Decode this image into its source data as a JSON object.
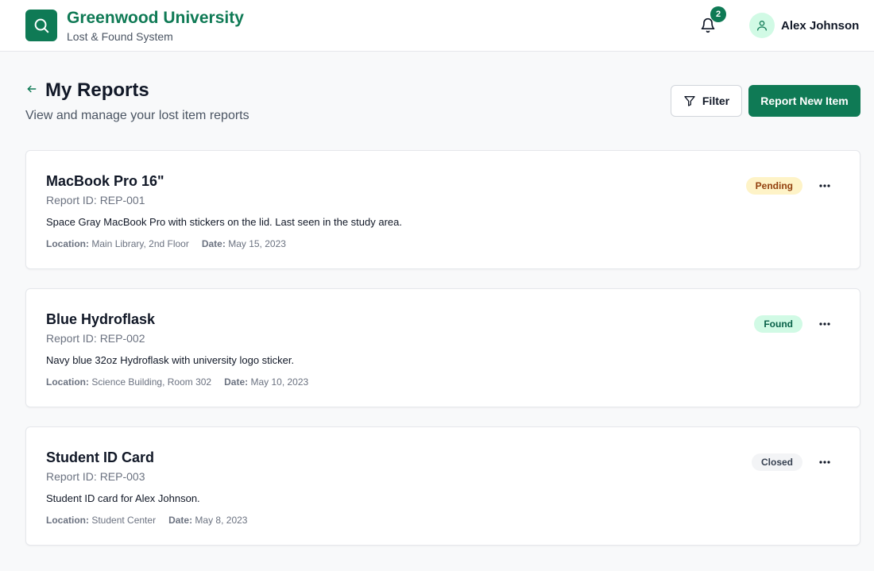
{
  "header": {
    "brand_title": "Greenwood University",
    "brand_subtitle": "Lost & Found System",
    "notification_count": "2",
    "user_name": "Alex Johnson",
    "accent_color": "#0f7a55"
  },
  "page": {
    "title": "My Reports",
    "subtitle": "View and manage your lost item reports",
    "filter_label": "Filter",
    "report_new_label": "Report New Item"
  },
  "reports": [
    {
      "title": "MacBook Pro 16\"",
      "report_id": "Report ID: REP-001",
      "description": "Space Gray MacBook Pro with stickers on the lid. Last seen in the study area.",
      "location_label": "Location:",
      "location": "Main Library, 2nd Floor",
      "date_label": "Date:",
      "date": "May 15, 2023",
      "status": "Pending",
      "status_color": "#fef3c7"
    },
    {
      "title": "Blue Hydroflask",
      "report_id": "Report ID: REP-002",
      "description": "Navy blue 32oz Hydroflask with university logo sticker.",
      "location_label": "Location:",
      "location": "Science Building, Room 302",
      "date_label": "Date:",
      "date": "May 10, 2023",
      "status": "Found",
      "status_color": "#d1fae5"
    },
    {
      "title": "Student ID Card",
      "report_id": "Report ID: REP-003",
      "description": "Student ID card for Alex Johnson.",
      "location_label": "Location:",
      "location": "Student Center",
      "date_label": "Date:",
      "date": "May 8, 2023",
      "status": "Closed",
      "status_color": "#f3f4f6"
    }
  ],
  "icons": {
    "logo": "search-icon",
    "notifications": "bell-icon",
    "avatar": "user-icon",
    "back": "arrow-left-icon",
    "filter": "filter-icon",
    "more": "more-horizontal-icon"
  }
}
